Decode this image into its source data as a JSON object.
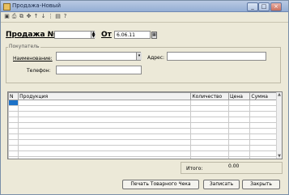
{
  "window": {
    "title": "Продажа-Новый",
    "controls": {
      "minimize": "_",
      "maximize": "□",
      "close": "×"
    }
  },
  "toolbar": {
    "icons": [
      "save-icon",
      "print-icon",
      "copy-icon",
      "move-icon",
      "arrow-up-icon",
      "arrow-down-icon",
      "tree-icon",
      "settings-icon",
      "help-icon"
    ]
  },
  "header": {
    "sale_label": "Продажа №",
    "sale_number": "",
    "date_label": "От",
    "date_value": "6.06.11"
  },
  "buyer": {
    "group_label": "Покупатель",
    "name_label": "Наименование:",
    "name_value": "",
    "address_label": "Адрес:",
    "address_value": "",
    "phone_label": "Телефон:",
    "phone_value": ""
  },
  "table": {
    "columns": [
      "N",
      "Продукция",
      "Количество",
      "Цена",
      "Сумма"
    ],
    "rows": 12
  },
  "totals": {
    "label": "Итого:",
    "value": "0.00"
  },
  "buttons": {
    "print_receipt": "Печать Товарного Чека",
    "save": "Записать",
    "close": "Закрыть"
  }
}
